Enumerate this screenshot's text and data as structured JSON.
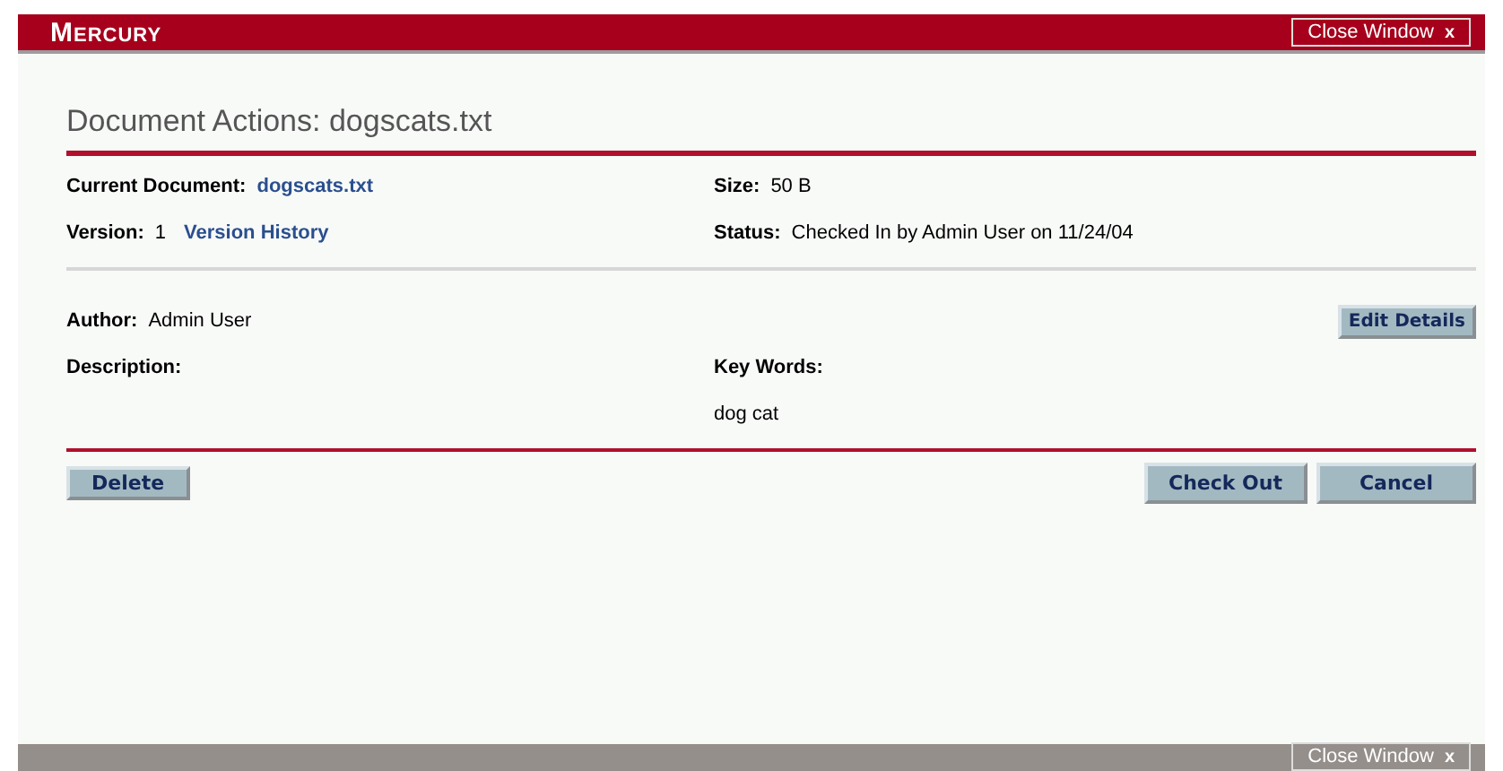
{
  "header": {
    "logo": "Mercury",
    "close_button": {
      "label": "Close Window",
      "glyph": "x"
    }
  },
  "title": "Document Actions: dogscats.txt",
  "info": [
    {
      "label": "Current Document:",
      "value": "dogscats.txt",
      "kind": "link"
    },
    {
      "label": "Size:",
      "value": "50 B",
      "kind": "text"
    },
    {
      "label": "Version:",
      "value": "1",
      "link": "Version History",
      "kind": "text_link"
    },
    {
      "label": "Status:",
      "value": "Checked In by Admin User on 11/24/04",
      "kind": "text"
    }
  ],
  "details": {
    "author_label": "Author:",
    "author": "Admin User",
    "edit_button": "Edit Details",
    "description_label": "Description:",
    "keywords_label": "Key Words:",
    "keywords": "dog cat"
  },
  "actions": {
    "left": [
      "Delete"
    ],
    "right": [
      "Check Out",
      "Cancel"
    ]
  },
  "footer": {
    "close_button": {
      "label": "Close Window",
      "glyph": "x"
    }
  }
}
